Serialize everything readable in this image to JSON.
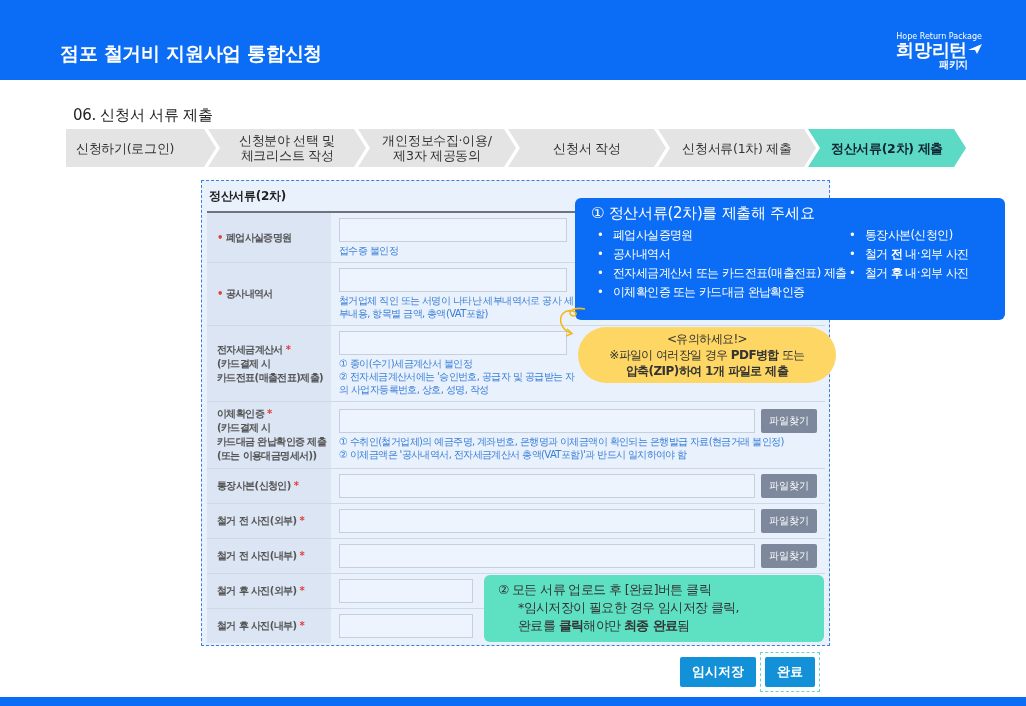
{
  "header": {
    "title": "점포 철거비 지원사업 통합신청",
    "logo": {
      "tagline": "Hope Return Package",
      "name": "희망리턴",
      "sub": "패키지"
    }
  },
  "section_title": "06. 신청서 서류 제출",
  "steps": [
    {
      "lines": [
        "신청하기(로그인)"
      ],
      "selected": false
    },
    {
      "lines": [
        "신청분야 선택 및",
        "체크리스트 작성"
      ],
      "selected": false
    },
    {
      "lines": [
        "개인정보수집·이용/",
        "제3자 제공동의"
      ],
      "selected": false
    },
    {
      "lines": [
        "신청서 작성"
      ],
      "selected": false
    },
    {
      "lines": [
        "신청서류(1차) 제출"
      ],
      "selected": false
    },
    {
      "lines": [
        "정산서류(2차) 제출"
      ],
      "selected": true
    }
  ],
  "form": {
    "title": "정산서류(2차)",
    "rows": [
      {
        "label_lines": [
          "폐업사실증명원"
        ],
        "mark_before": "•",
        "hints": [
          "접수증 불인정"
        ]
      },
      {
        "label_lines": [
          "공사내역서"
        ],
        "mark_before": "•",
        "hints": [
          "철거업체 직인 또는 서명이 나타난 세부내역서로 공사 세부내용, 항목별 금액, 총액(VAT포함)"
        ]
      },
      {
        "label_lines": [
          "전자세금계산서",
          "(카드결제 시",
          "카드전표(매출전표)제출)"
        ],
        "mark_after": "*",
        "hints": [
          "① 종이(수기)세금계산서 불인정",
          "② 전자세금계산서에는 '승인번호, 공급자 및 공급받는 자의 사업자등록번호, 상호, 성명, 작성"
        ]
      },
      {
        "label_lines": [
          "이체확인증",
          "(카드결제 시",
          "카드대금 완납확인증 제출",
          "(또는 이용대금명세서))"
        ],
        "mark_after": "*",
        "hints": [
          "① 수취인(철거업체)의 예금주명, 계좌번호, 은행명과 이체금액이 확인되는 은행발급 자료(현금거래 불인정)",
          "② 이체금액은 '공사내역서, 전자세금계산서 총액(VAT포함)'과 반드시 일치하여야 함"
        ],
        "button": "파일찾기"
      },
      {
        "label_lines": [
          "통장사본(신청인)"
        ],
        "mark_after": "*",
        "button": "파일찾기"
      },
      {
        "label_lines": [
          "철거 전 사진(외부)"
        ],
        "mark_after": "*",
        "button": "파일찾기"
      },
      {
        "label_lines": [
          "철거 전 사진(내부)"
        ],
        "mark_after": "*",
        "button": "파일찾기"
      },
      {
        "label_lines": [
          "철거 후 사진(외부)"
        ],
        "mark_after": "*"
      },
      {
        "label_lines": [
          "철거 후 사진(내부)"
        ],
        "mark_after": "*"
      }
    ]
  },
  "callout_1": {
    "title": "① 정산서류(2차)를 제출해 주세요",
    "bullet": "•",
    "left_items": [
      "폐업사실증명원",
      "공사내역서",
      "전자세금계산서 또는 카드전표(매출전표) 제출",
      "이체확인증 또는 카드대금 완납확인증"
    ],
    "right_items": [
      "통장사본(신청인)",
      "철거 **전** 내·외부 사진",
      "철거 **후** 내·외부 사진"
    ]
  },
  "notice": {
    "title": "<유의하세요!>",
    "lines": [
      "※파일이 여러장일 경우 **PDF병합** 또는",
      "**압축(ZIP)하여 1개 파일로 제출**"
    ]
  },
  "callout_2": {
    "lines": [
      "② 모든 서류 업로드 후 [완료]버튼 클릭",
      "*임시저장이 필요한 경우 임시저장 클릭,",
      "완료를 **클릭**해야만 **최종 완료**됨"
    ]
  },
  "actions": [
    {
      "label": "임시저장",
      "highlighted": false
    },
    {
      "label": "완료",
      "highlighted": true
    }
  ]
}
